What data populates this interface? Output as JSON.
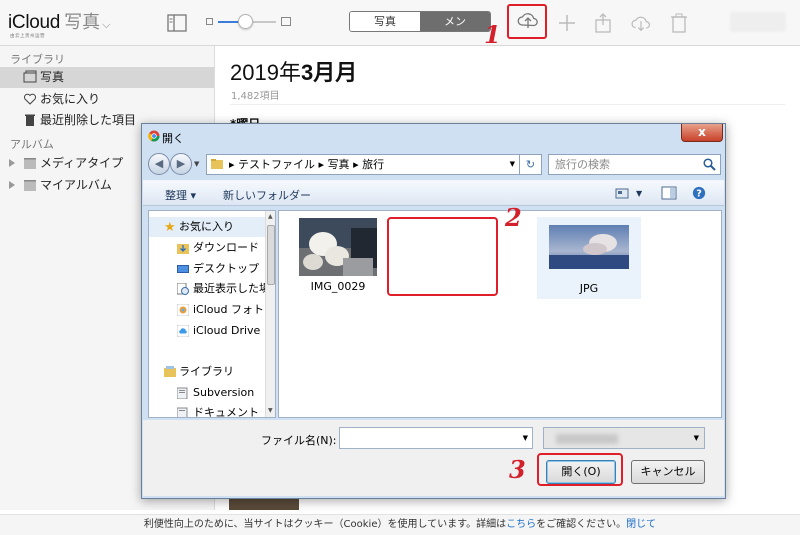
{
  "topbar": {
    "brand": "iCloud",
    "app_name": "写真",
    "brand_sub": "由云上贵州运营",
    "segments": [
      "写真",
      "メン"
    ]
  },
  "sidebar": {
    "library_header": "ライブラリ",
    "library_items": [
      {
        "label": "写真",
        "icon": "photos-icon",
        "selected": true
      },
      {
        "label": "お気に入り",
        "icon": "heart-icon",
        "selected": false
      },
      {
        "label": "最近削除した項目",
        "icon": "trash-icon",
        "selected": false
      }
    ],
    "album_header": "アルバム",
    "album_items": [
      {
        "label": "メディアタイプ",
        "icon": "folder-icon"
      },
      {
        "label": "マイアルバム",
        "icon": "folder-icon"
      }
    ]
  },
  "main": {
    "title_year": "2019年",
    "title_month": "3月月",
    "count": "1,482項目",
    "partial_text": "*曜日"
  },
  "dialog": {
    "title": "開く",
    "close": "x",
    "address": [
      "テストファイル",
      "写真",
      "旅行"
    ],
    "search_placeholder": "旅行の検索",
    "organize": "整理 ▾",
    "new_folder": "新しいフォルダー",
    "tree": {
      "favorites": "お気に入り",
      "downloads": "ダウンロード",
      "desktop": "デスクトップ",
      "recent": "最近表示した場",
      "icloud_photos": "iCloud フォト",
      "icloud_drive": "iCloud Drive",
      "libraries": "ライブラリ",
      "subversion": "Subversion",
      "documents": "ドキュメント"
    },
    "files": [
      {
        "name": "IMG_0029"
      },
      {
        "name": "JPG"
      }
    ],
    "filename_label": "ファイル名(N):",
    "filename_value": "",
    "open_button": "開く(O)",
    "cancel_button": "キャンセル"
  },
  "steps": [
    "1",
    "2",
    "3"
  ],
  "cookie": {
    "text_before": "利便性向上のために、当サイトはクッキー（Cookie）を使用しています。詳細は",
    "link_here": "こちら",
    "text_after": "をご確認ください。",
    "link_close": "閉じて"
  },
  "colors": {
    "accent_red": "#e01e2a",
    "link_blue": "#1a6fc9",
    "dialog_frame": "#cfe0f3"
  }
}
